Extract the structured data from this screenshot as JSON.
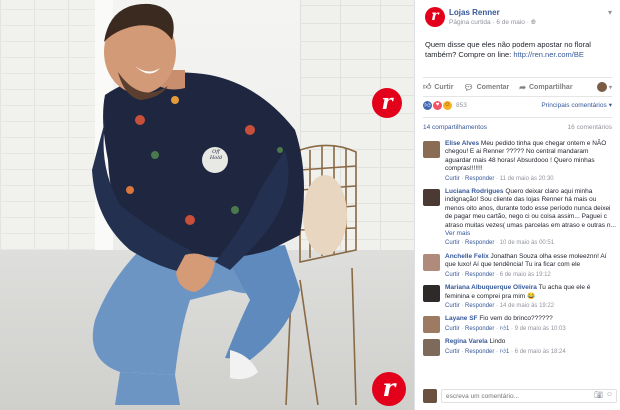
{
  "post": {
    "page_name": "Lojas Renner",
    "subtitle": "Página curtida",
    "date": "6 de maio",
    "globe_icon": "globe-icon",
    "menu_icon": "chevron-down-icon",
    "text_before_link": "Quem disse que eles não podem apostar no floral também? Compre on line: ",
    "link": "http://ren.ner.com/BE"
  },
  "brand": {
    "logo_letter": "r",
    "color": "#e2001a"
  },
  "photo": {
    "shirt_print": "Off\nHold"
  },
  "actions": {
    "like": "Curtir",
    "comment": "Comentar",
    "share": "Compartilhar"
  },
  "reactions": {
    "count": "853",
    "filter": "Principais comentários",
    "icons": [
      "like-icon",
      "love-icon",
      "haha-icon"
    ]
  },
  "shares": {
    "label": "14 compartilhamentos",
    "comments": "16 comentários"
  },
  "comments": [
    {
      "name": "Elise Alves",
      "text": "Meu pedido tinha que chegar ontem e NÃO chegou! E ai Renner ????? No central mandaram aguardar mais 48 horas! Absurdooo ! Quero minhas compras!!!!!!!",
      "action": "Curtir",
      "reply": "Responder",
      "time": "11 de maio às 20:30",
      "likes": "",
      "avatar_color": "#8a6b53"
    },
    {
      "name": "Luciana Rodrigues",
      "text": "Quero deixar claro aqui minha indignação! Sou cliente das lojas Renner há mais ou menos oito anos, durante todo esse período nunca deixei de pagar meu cartão, nego ci ou coisa assim... Paguei c atraso muitas vezes( umas parcelas em atraso e outras n...",
      "more": "Ver mais",
      "action": "Curtir",
      "reply": "Responder",
      "time": "10 de maio às 00:51",
      "likes": "",
      "avatar_color": "#4b3a33"
    },
    {
      "name": "Anchelle Felix",
      "text": "Jonathan Souza olha esse moleeznn! Aí que luxo! Aí que tendência! Tu ira ficar com ele",
      "action": "Curtir",
      "reply": "Responder",
      "time": "6 de maio às 19:12",
      "likes": "",
      "avatar_color": "#b08a7a"
    },
    {
      "name": "Mariana Albuquerque Oliveira",
      "text": "Tu acha que ele é feminina e comprei pra mim",
      "emoji": "😂",
      "action": "Curtir",
      "reply": "Responder",
      "time": "14 de maio às 19:22",
      "likes": "",
      "avatar_color": "#2f2a2a"
    },
    {
      "name": "Layane SF",
      "text": "Fio vem do brinco??????",
      "action": "Curtir",
      "reply": "Responder",
      "time": "9 de maio às 10:03",
      "likes": "1",
      "avatar_color": "#9c7b62"
    },
    {
      "name": "Regina Varela",
      "text": "Lindo",
      "action": "Curtir",
      "reply": "Responder",
      "time": "6 de maio às 18:24",
      "likes": "1",
      "avatar_color": "#7d6a5a"
    }
  ],
  "composer": {
    "placeholder": "escreva um comentário...",
    "camera_icon": "camera-icon",
    "emoji_icon": "emoji-icon"
  }
}
